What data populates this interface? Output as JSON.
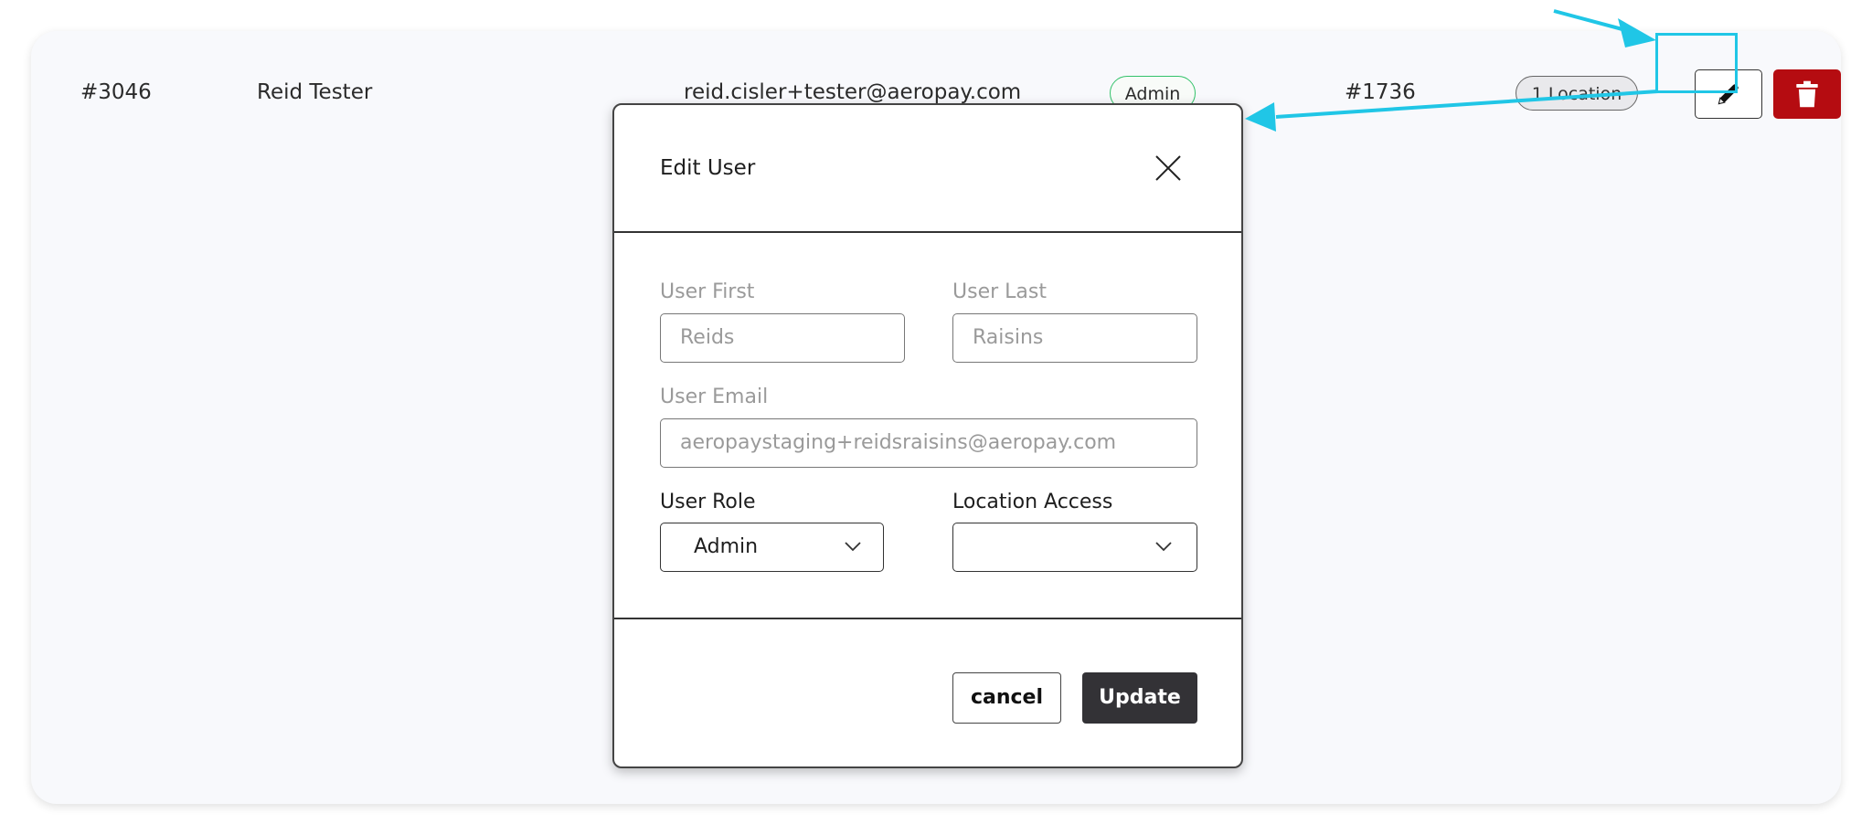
{
  "row": {
    "id": "#3046",
    "name": "Reid Tester",
    "email": "reid.cisler+tester@aeropay.com",
    "role_badge": "Admin",
    "number": "#1736",
    "locations_badge": "1 Location",
    "edit_icon": "pencil-icon",
    "delete_icon": "trash-icon"
  },
  "modal": {
    "title": "Edit User",
    "close_icon": "close-icon",
    "first_label": "User First",
    "first_placeholder": "Reids",
    "last_label": "User Last",
    "last_placeholder": "Raisins",
    "email_label": "User Email",
    "email_placeholder": "aeropaystaging+reidsraisins@aeropay.com",
    "role_label": "User Role",
    "role_value": "Admin",
    "location_label": "Location Access",
    "location_value": "",
    "cancel_label": "cancel",
    "update_label": "Update"
  },
  "colors": {
    "annotation": "#20c6e6",
    "delete": "#b50c11",
    "update": "#333236",
    "admin_badge_border": "#33c26a"
  }
}
